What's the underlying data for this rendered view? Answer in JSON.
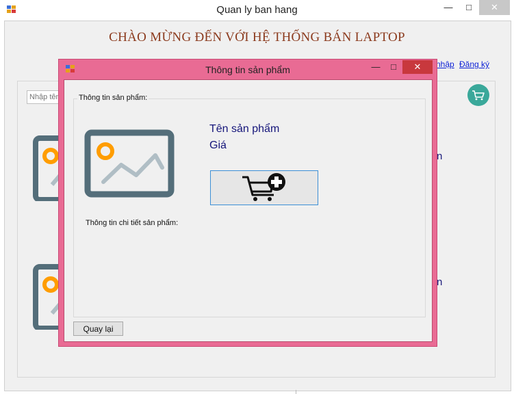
{
  "main_window": {
    "title": "Quan ly ban hang",
    "controls": {
      "minimize": "—",
      "maximize": "□",
      "close": "✕"
    },
    "heading": "CHÀO MỪNG ĐẾN VỚI HỆ THỐNG BÁN LAPTOP",
    "links": {
      "login_partial": "nhập",
      "register": "Đăng ký"
    },
    "search": {
      "placeholder": "Nhập tên"
    },
    "background_products": [
      {
        "name_partial": "n"
      },
      {
        "name_partial": "n"
      }
    ]
  },
  "dialog": {
    "title": "Thông tin sản phẩm",
    "controls": {
      "minimize": "—",
      "maximize": "□",
      "close": "✕"
    },
    "group_label": "Thông tin sản phẩm:",
    "product_name": "Tên sản phẩm",
    "product_price": "Giá",
    "detail_label": "Thông tin chi tiết sản phẩm:",
    "back_button": "Quay lại",
    "icons": {
      "product_image": "image-placeholder-icon",
      "add_to_cart": "cart-plus-icon"
    }
  },
  "colors": {
    "dialog_frame": "#e96b94",
    "heading": "#8b3a1d",
    "link": "#0b1fd6",
    "product_text": "#15157a",
    "cart_badge": "#3aa89a",
    "image_frame": "#546e7a",
    "image_sun": "#ff9d00",
    "image_mountain": "#b0bec5"
  }
}
